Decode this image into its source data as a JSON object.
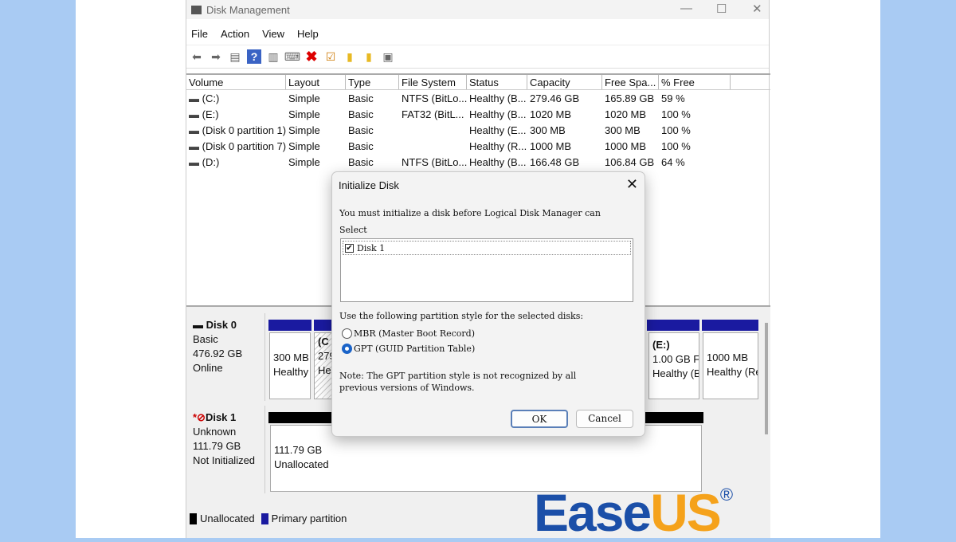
{
  "window": {
    "title": "Disk Management",
    "minimize": "—",
    "maximize": "☐",
    "close": "✕"
  },
  "menu": [
    "File",
    "Action",
    "View",
    "Help"
  ],
  "toolbar_icons": [
    "back-icon",
    "forward-icon",
    "console-icon",
    "help-icon",
    "properties-icon",
    "connect-icon",
    "delete-icon",
    "check-icon",
    "folder-up-icon",
    "folder-search-icon",
    "list-icon"
  ],
  "columns": [
    "Volume",
    "Layout",
    "Type",
    "File System",
    "Status",
    "Capacity",
    "Free Spa...",
    "% Free"
  ],
  "volumes": [
    [
      "(C:)",
      "Simple",
      "Basic",
      "NTFS (BitLo...",
      "Healthy (B...",
      "279.46 GB",
      "165.89 GB",
      "59 %"
    ],
    [
      "(E:)",
      "Simple",
      "Basic",
      "FAT32 (BitL...",
      "Healthy (B...",
      "1020 MB",
      "1020 MB",
      "100 %"
    ],
    [
      "(Disk 0 partition 1)",
      "Simple",
      "Basic",
      "",
      "Healthy (E...",
      "300 MB",
      "300 MB",
      "100 %"
    ],
    [
      "(Disk 0 partition 7)",
      "Simple",
      "Basic",
      "",
      "Healthy (R...",
      "1000 MB",
      "1000 MB",
      "100 %"
    ],
    [
      "(D:)",
      "Simple",
      "Basic",
      "NTFS (BitLo...",
      "Healthy (B...",
      "166.48 GB",
      "106.84 GB",
      "64 %"
    ]
  ],
  "disks": [
    {
      "name": "Disk 0",
      "type": "Basic",
      "size": "476.92 GB",
      "state": "Online",
      "partitions": [
        {
          "l1": "",
          "l2": "300 MB",
          "l3": "Healthy"
        },
        {
          "l1": "(C",
          "l2": "279",
          "l3": "He"
        },
        {
          "l1": "(E:)",
          "l2": "1.00 GB FA",
          "l3": "Healthy (B"
        },
        {
          "l1": "",
          "l2": "1000 MB",
          "l3": "Healthy (Re"
        }
      ]
    },
    {
      "name": "Disk 1",
      "type": "Unknown",
      "size": "111.79 GB",
      "state": "Not Initialized",
      "partitions": [
        {
          "l1": "111.79 GB",
          "l2": "Unallocated"
        }
      ]
    }
  ],
  "legend": [
    "Unallocated",
    "Primary partition"
  ],
  "colors": {
    "primary": "#1a1aa0",
    "unallocated": "#000000",
    "background": "#a9cbf3",
    "brand_blue": "#1b4fa8",
    "brand_orange": "#f5a21b"
  },
  "dialog": {
    "title": "Initialize Disk",
    "message": "You must initialize a disk before Logical Disk Manager can",
    "select_label": "Select",
    "disk_item": "Disk 1",
    "disk_checked": true,
    "style_prompt": "Use the following partition style for the selected disks:",
    "mbr": "MBR (Master Boot Record)",
    "gpt": "GPT (GUID Partition Table)",
    "selected_style": "GPT",
    "note1": "Note: The GPT partition style is not recognized by all",
    "note2": "previous versions of Windows.",
    "ok": "OK",
    "cancel": "Cancel"
  },
  "watermark": {
    "text_a": "Ease",
    "text_b": "US",
    "reg": "®"
  }
}
